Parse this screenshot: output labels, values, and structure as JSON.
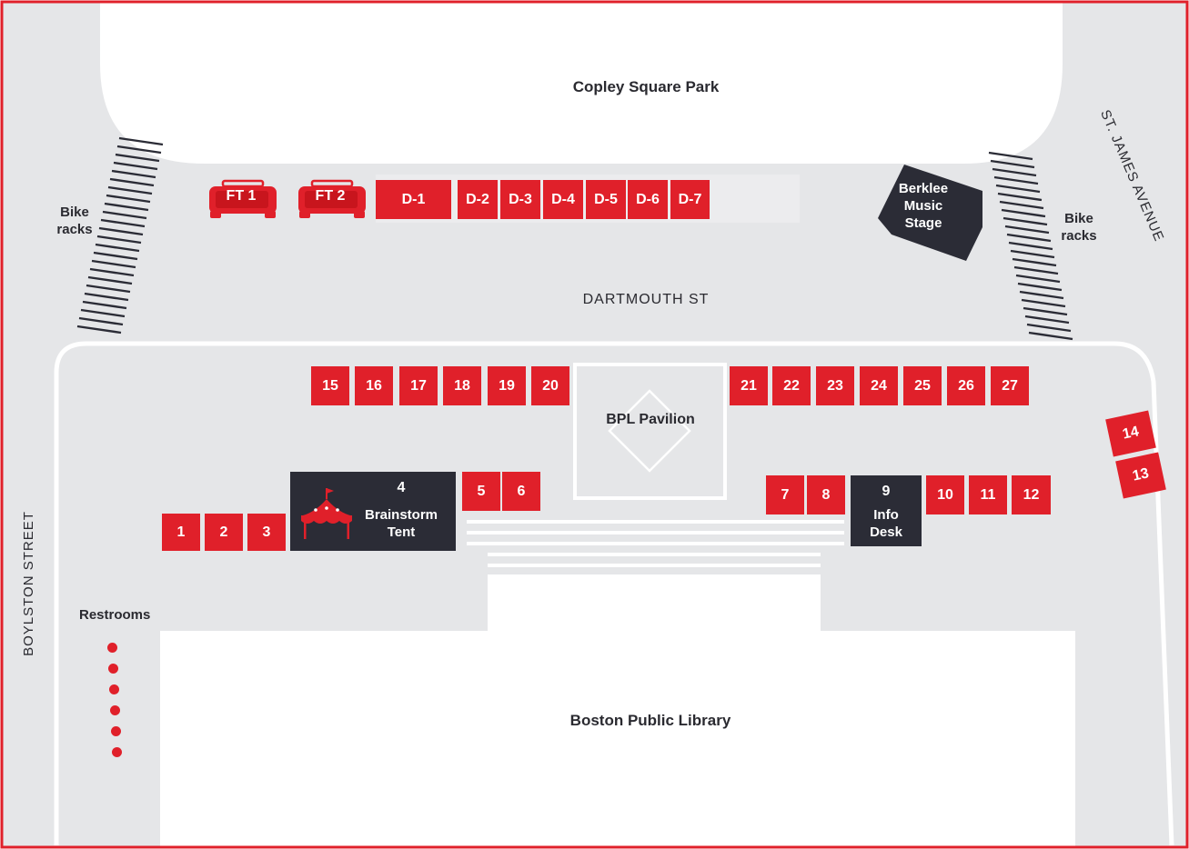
{
  "colors": {
    "booth_red": "#e0202a",
    "dark_booth": "#2b2c36",
    "street_gray": "#e5e6e8",
    "border_red": "#e0202a"
  },
  "labels": {
    "copley_square_park": "Copley Square Park",
    "dartmouth_st": "DARTMOUTH ST",
    "st_james_avenue": "ST. JAMES AVENUE",
    "boylston_street": "BOYLSTON STREET",
    "boston_public_library": "Boston Public Library",
    "restrooms": "Restrooms",
    "bike_racks_left": "Bike racks",
    "bike_racks_right": "Bike racks",
    "bpl_pavilion": "BPL Pavilion"
  },
  "food_trucks": [
    "FT 1",
    "FT 2"
  ],
  "d_booths": [
    "D-1",
    "D-2",
    "D-3",
    "D-4",
    "D-5",
    "D-6",
    "D-7"
  ],
  "booths": [
    "1",
    "2",
    "3",
    "5",
    "6",
    "7",
    "8",
    "10",
    "11",
    "12",
    "13",
    "14",
    "15",
    "16",
    "17",
    "18",
    "19",
    "20",
    "21",
    "22",
    "23",
    "24",
    "25",
    "26",
    "27"
  ],
  "brainstorm_tent": {
    "number": "4",
    "label": "Brainstorm Tent",
    "icon": "tent-icon"
  },
  "info_desk": {
    "number": "9",
    "label": "Info Desk"
  },
  "berklee_stage": {
    "label": "Berklee Music Stage"
  }
}
